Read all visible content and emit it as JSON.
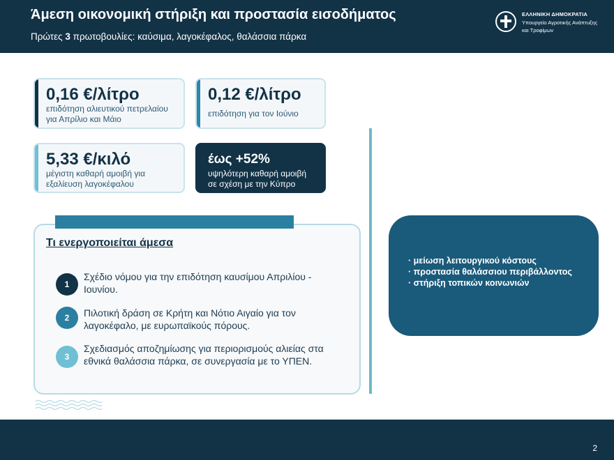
{
  "header": {
    "title": "Άμεση οικονομική στήριξη και προστασία εισοδήματος",
    "subtitle_prefix": "Πρώτες ",
    "subtitle_number": "3",
    "subtitle_suffix": " πρωτοβουλίες: καύσιμα, λαγοκέφαλος, θαλάσσια πάρκα",
    "logo_line1": "ΕΛΛΗΝΙΚΗ ΔΗΜΟΚΡΑΤΙΑ",
    "logo_line2": "Υπουργείο Αγροτικής Ανάπτυξης",
    "logo_line3": "και Τροφίμων"
  },
  "stats": [
    {
      "value": "0,16 €/λίτρο",
      "desc_line1": "επιδότηση αλιευτικού πετρελαίου",
      "desc_line2": "για Απρίλιο και Μάιο"
    },
    {
      "value": "0,12 €/λίτρο",
      "desc_line1": "επιδότηση για τον Ιούνιο",
      "desc_line2": ""
    },
    {
      "value": "5,33 €/κιλό",
      "desc_line1": "μέγιστη καθαρή αμοιβή για",
      "desc_line2": "εξαλίευση λαγοκέφαλου"
    },
    {
      "value": "έως +52%",
      "desc_line1": "υψηλότερη καθαρή αμοιβή",
      "desc_line2": "σε σχέση με την Κύπρο"
    }
  ],
  "actions": {
    "title": "Τι ενεργοποιείται άμεσα",
    "steps": [
      {
        "num": "1",
        "line1": "Σχέδιο νόμου για την επιδότηση καυσίμου Απριλίου -",
        "line2": "Ιουνίου."
      },
      {
        "num": "2",
        "line1": "Πιλοτική δράση σε Κρήτη και Νότιο Αιγαίο για τον",
        "line2": "λαγοκέφαλο, με ευρωπαϊκούς πόρους."
      },
      {
        "num": "3",
        "line1": "Σχεδιασμός αποζημίωσης για περιορισμούς αλιείας στα",
        "line2": "εθνικά θαλάσσια πάρκα, σε συνεργασία με το ΥΠΕΝ."
      }
    ]
  },
  "benefits": [
    "· μείωση λειτουργικού κόστους",
    "· προστασία θαλάσσιου περιβάλλοντος",
    "· στήριξη τοπικών κοινωνιών"
  ],
  "footer": {
    "page_number": "2"
  },
  "colors": {
    "navy": "#123246",
    "teal": "#2b7fa0",
    "light_teal": "#6fc0d4",
    "benefits_bg": "#1a5a7a"
  },
  "icons": {
    "logo": "greek-cross-emblem-icon",
    "decoration": "waves-icon"
  }
}
